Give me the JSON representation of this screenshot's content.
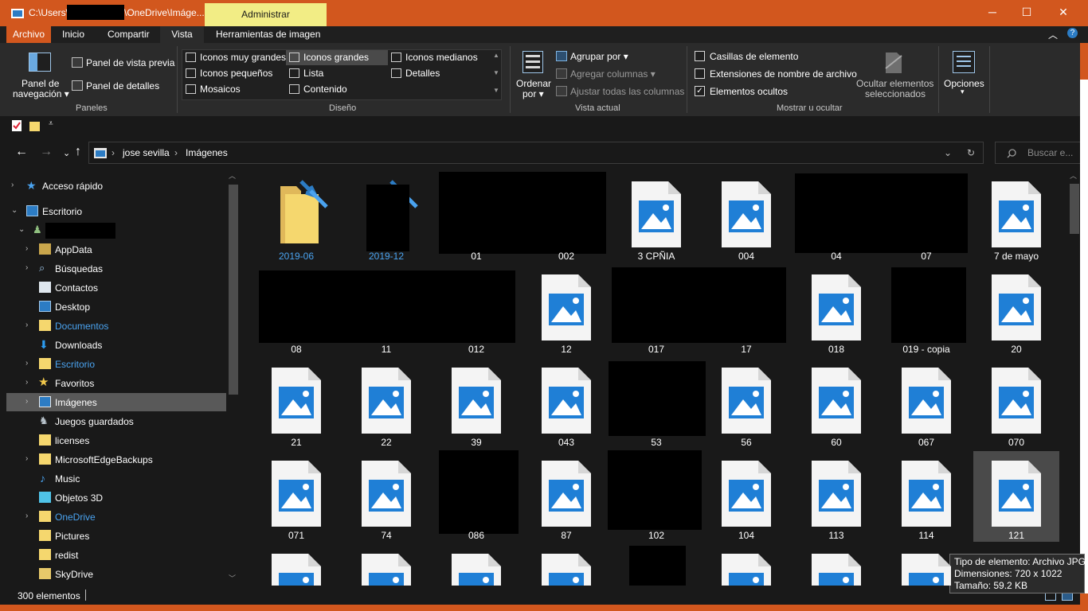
{
  "window": {
    "title_prefix": "C:\\Users\\",
    "title_suffix": "\\OneDrive\\Imáge...",
    "context_tab": "Administrar",
    "minimize": "─",
    "maximize": "☐",
    "close": "✕"
  },
  "ribbon_tabs": [
    {
      "label": "Archivo"
    },
    {
      "label": "Inicio"
    },
    {
      "label": "Compartir"
    },
    {
      "label": "Vista"
    },
    {
      "label": "Herramientas de imagen"
    }
  ],
  "ribbon": {
    "panels": {
      "nav_pane": "Panel de",
      "nav_pane2": "navegación ▾",
      "preview_pane": "Panel de vista previa",
      "details_pane": "Panel de detalles",
      "group_label": "Paneles"
    },
    "layout": {
      "items": [
        {
          "label": "Iconos muy grandes"
        },
        {
          "label": "Iconos grandes"
        },
        {
          "label": "Iconos medianos"
        },
        {
          "label": "Iconos pequeños"
        },
        {
          "label": "Lista"
        },
        {
          "label": "Detalles"
        },
        {
          "label": "Mosaicos"
        },
        {
          "label": "Contenido"
        }
      ],
      "group_label": "Diseño"
    },
    "current_view": {
      "sort_by": "Ordenar",
      "sort_by2": "por ▾",
      "group_by": "Agrupar por ▾",
      "add_columns": "Agregar columnas ▾",
      "fit_columns": "Ajustar todas las columnas",
      "group_label": "Vista actual"
    },
    "show_hide": {
      "item_checkboxes": "Casillas de elemento",
      "file_extensions": "Extensiones de nombre de archivo",
      "hidden_items": "Elementos ocultos",
      "hide_selected": "Ocultar elementos",
      "hide_selected2": "seleccionados",
      "group_label": "Mostrar u ocultar"
    },
    "options": {
      "label": "Opciones",
      "arrow": "▾"
    }
  },
  "address": {
    "crumbs": [
      "jose sevilla",
      "Imágenes"
    ],
    "sep": "›",
    "search_placeholder": "Buscar e..."
  },
  "sidebar": {
    "items": [
      {
        "label": "Acceso rápido"
      },
      {
        "label": "Escritorio"
      },
      {
        "label": ""
      },
      {
        "label": "AppData"
      },
      {
        "label": "Búsquedas"
      },
      {
        "label": "Contactos"
      },
      {
        "label": "Desktop"
      },
      {
        "label": "Documentos"
      },
      {
        "label": "Downloads"
      },
      {
        "label": "Escritorio"
      },
      {
        "label": "Favoritos"
      },
      {
        "label": "Imágenes"
      },
      {
        "label": "Juegos guardados"
      },
      {
        "label": "licenses"
      },
      {
        "label": "MicrosoftEdgeBackups"
      },
      {
        "label": "Music"
      },
      {
        "label": "Objetos 3D"
      },
      {
        "label": "OneDrive"
      },
      {
        "label": "Pictures"
      },
      {
        "label": "redist"
      },
      {
        "label": "SkyDrive"
      }
    ]
  },
  "files": {
    "row1": [
      "2019-06",
      "2019-12",
      "01",
      "002",
      "3 CPÑIA",
      "004",
      "04",
      "07",
      "7 de mayo"
    ],
    "row2": [
      "08",
      "11",
      "012",
      "12",
      "017",
      "17",
      "018",
      "019 - copia",
      "20"
    ],
    "row3": [
      "21",
      "22",
      "39",
      "043",
      "53",
      "56",
      "60",
      "067",
      "070"
    ],
    "row4": [
      "071",
      "74",
      "086",
      "87",
      "102",
      "104",
      "113",
      "114",
      "121"
    ]
  },
  "status": {
    "count": "300 elementos"
  },
  "tooltip": {
    "type": "Tipo de elemento: Archivo JPG",
    "dims": "Dimensiones: 720 x 1022",
    "size": "Tamaño: 59.2 KB"
  },
  "colors": {
    "accent": "#d2571e",
    "context_tab": "#f2ed85",
    "link": "#4aa3f0",
    "image_icon": "#1f7fd6"
  }
}
